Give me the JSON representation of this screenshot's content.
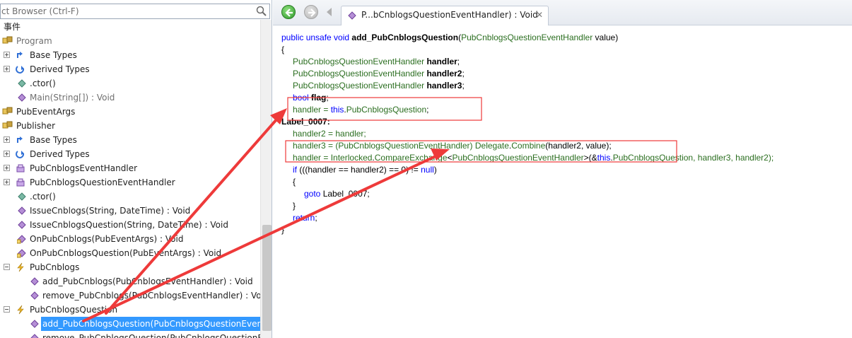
{
  "search": {
    "placeholder": "ct Browser (Ctrl-F)"
  },
  "tree": {
    "rows": [
      {
        "label": "事件"
      },
      {
        "label": "Program"
      },
      {
        "label": "Base Types"
      },
      {
        "label": "Derived Types"
      },
      {
        "label": ".ctor()"
      },
      {
        "label": "Main(String[]) : Void"
      },
      {
        "label": "PubEventArgs"
      },
      {
        "label": "Publisher"
      },
      {
        "label": "Base Types"
      },
      {
        "label": "Derived Types"
      },
      {
        "label": "PubCnblogsEventHandler"
      },
      {
        "label": "PubCnblogsQuestionEventHandler"
      },
      {
        "label": ".ctor()"
      },
      {
        "label": "IssueCnblogs(String, DateTime) : Void"
      },
      {
        "label": "IssueCnblogsQuestion(String, DateTime) : Void"
      },
      {
        "label": "OnPubCnblogs(PubEventArgs) : Void"
      },
      {
        "label": "OnPubCnblogsQuestion(PubEventArgs) : Void"
      },
      {
        "label": "PubCnblogs"
      },
      {
        "label": "add_PubCnblogs(PubCnblogsEventHandler) : Void"
      },
      {
        "label": "remove_PubCnblogs(PubCnblogsEventHandler) : Void"
      },
      {
        "label": "PubCnblogsQuestion"
      },
      {
        "label": "add_PubCnblogsQuestion(PubCnblogsQuestionEventHandler) : Void"
      },
      {
        "label": "remove_PubCnblogsQuestion(PubCnblogsQuestionEventHandler) : Void"
      }
    ]
  },
  "tab": {
    "label": "P...bCnblogsQuestionEventHandler) : Void",
    "close": "✕"
  },
  "code": {
    "l1": {
      "kw": "public unsafe void ",
      "name": "add_PubCnblogsQuestion",
      "open": "(",
      "type": "PubCnblogsQuestionEventHandler",
      "rest": " value)"
    },
    "l2": "{",
    "l3": {
      "type": "PubCnblogsQuestionEventHandler ",
      "var": "handler",
      "end": ";"
    },
    "l4": {
      "type": "PubCnblogsQuestionEventHandler ",
      "var": "handler2",
      "end": ";"
    },
    "l5": {
      "type": "PubCnblogsQuestionEventHandler ",
      "var": "handler3",
      "end": ";"
    },
    "l6": {
      "kw": "bool ",
      "var": "flag",
      "end": ";"
    },
    "l7": {
      "a": "handler = ",
      "kw": "this",
      "b": ".",
      "ty": "PubCnblogsQuestion",
      "end": ";"
    },
    "l8": "Label_0007:",
    "l9": "handler2 = handler;",
    "l10": {
      "a": "handler3 = (",
      "ty": "PubCnblogsQuestionEventHandler",
      "b": ") ",
      "ty2": "Delegate",
      "c": ".",
      "m": "Combine",
      "d": "(handler2, value);"
    },
    "l11": {
      "a": "handler = ",
      "ty": "Interlocked",
      "b": ".",
      "m": "CompareExchange",
      "c": "<",
      "ty2": "PubCnblogsQuestionEventHandler",
      "d": ">(&",
      "kw": "this",
      "e": ".",
      "ty3": "PubCnblogsQuestion",
      "f": ", handler3, handler2);"
    },
    "l12": {
      "kw": "if",
      "a": " (((handler == handler2) == 0) != ",
      "kw2": "null",
      "b": ")"
    },
    "l13": "{",
    "l14": {
      "kw": "goto",
      "a": " Label_0007;"
    },
    "l15": "}",
    "l16": {
      "kw": "return",
      "a": ";"
    },
    "l17": "}"
  },
  "colors": {
    "arrow": "#ee3a3a",
    "selection": "#3399ff",
    "keyword": "#0000ff",
    "type": "#2b6e20"
  }
}
